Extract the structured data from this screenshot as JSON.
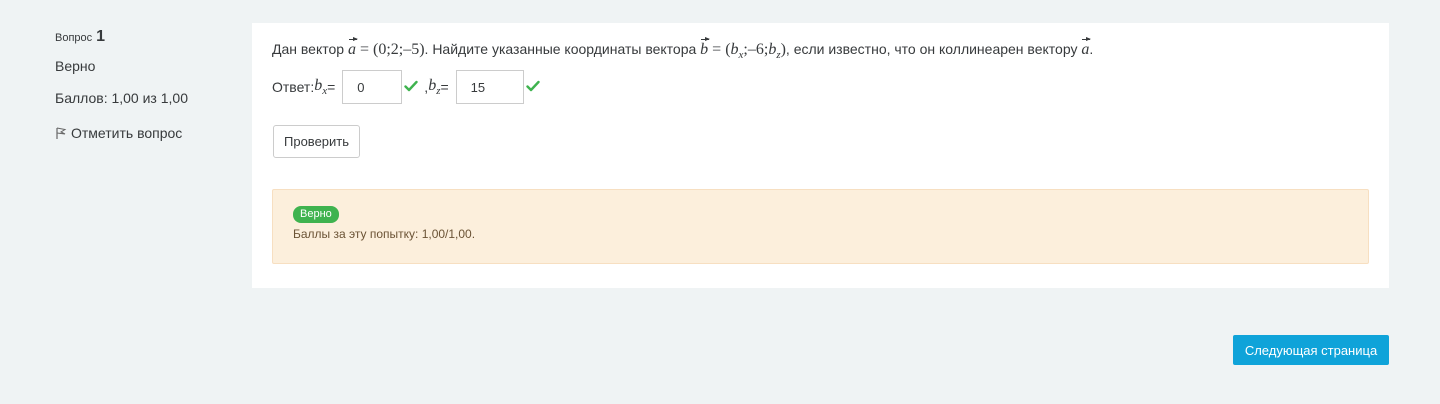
{
  "question_info": {
    "label": "Вопрос",
    "number": "1",
    "state": "Верно",
    "grade": "Баллов: 1,00 из 1,00",
    "flag_label": "Отметить вопрос"
  },
  "question": {
    "text_intro": "Дан вектор ",
    "vec_a": "a",
    "a_coords": " = (0;2;–5)",
    "text_mid": ". Найдите указанные координаты вектора ",
    "vec_b": "b",
    "b_coords_eq": " = (",
    "b_x": "b",
    "b_x_sub": "x",
    "b_mid": ";–6;",
    "b_z": "b",
    "b_z_sub": "z",
    "b_close": ")",
    "text_end": ", если известно, что он коллинеарен вектору ",
    "vec_a2": "a",
    "period": "."
  },
  "answer": {
    "label": "Ответ: ",
    "bx_var": "b",
    "bx_sub": "x",
    "bx_eq": " =",
    "bx_value": "0",
    "separator": " , ",
    "bz_var": "b",
    "bz_sub": "z",
    "bz_eq": " =",
    "bz_value": "15"
  },
  "check_button": "Проверить",
  "outcome": {
    "badge": "Верно",
    "feedback": "Баллы за эту попытку: 1,00/1,00."
  },
  "next_button": "Следующая страница",
  "colors": {
    "background": "#eff3f4",
    "correct_green": "#3fb34f",
    "outcome_bg": "#fcefdc",
    "primary_button": "#0fa3d9"
  },
  "icons": {
    "flag": "flag-icon",
    "check": "checkmark-icon"
  }
}
